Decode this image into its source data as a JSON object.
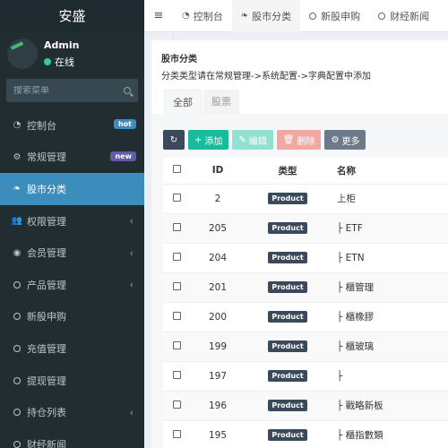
{
  "brand": "安盛",
  "user": {
    "name": "Admin",
    "status": "在线"
  },
  "search": {
    "placeholder": "搜索菜单"
  },
  "menu": [
    {
      "label": "控制台",
      "icon": "dashboard-icon",
      "badge": "hot"
    },
    {
      "label": "常规管理",
      "icon": "cogs-icon",
      "badge": "new"
    },
    {
      "label": "股市分类",
      "icon": "leaf-icon",
      "active": true
    },
    {
      "label": "权限管理",
      "icon": "group-icon",
      "caret": "‹"
    },
    {
      "label": "会员管理",
      "icon": "user-circle-icon",
      "caret": "‹"
    },
    {
      "label": "产品管理",
      "icon": "circle-icon",
      "caret": "‹"
    },
    {
      "label": "新股申购",
      "icon": "circle-icon"
    },
    {
      "label": "充值管理",
      "icon": "circle-icon"
    },
    {
      "label": "提现管理",
      "icon": "circle-icon"
    },
    {
      "label": "持仓列表",
      "icon": "circle-icon",
      "caret": "‹"
    },
    {
      "label": "财经新闻",
      "icon": "circle-icon"
    }
  ],
  "topbar": {
    "tabs": [
      {
        "label": "控制台",
        "icon": "dashboard-icon"
      },
      {
        "label": "股市分类",
        "icon": "leaf-icon",
        "active": true
      },
      {
        "label": "新股申购",
        "icon": "circle-icon"
      },
      {
        "label": "财经新闻",
        "icon": "circle-icon"
      }
    ]
  },
  "panel": {
    "title": "股市分类",
    "description": "分类类型请在常规管理->系统配置->字典配置中添加",
    "subtabs": [
      "全部",
      "股票"
    ]
  },
  "toolbar": {
    "add": "添加",
    "edit": "编辑",
    "delete": "删除",
    "more": "更多"
  },
  "table": {
    "headers": {
      "id": "ID",
      "type": "类型",
      "name": "名称"
    },
    "rows": [
      {
        "id": "2",
        "type": "Product",
        "name": "上柜"
      },
      {
        "id": "205",
        "type": "Product",
        "name": "├ ETF"
      },
      {
        "id": "204",
        "type": "Product",
        "name": "├ ETN"
      },
      {
        "id": "201",
        "type": "Product",
        "name": "├ 櫃管理"
      },
      {
        "id": "200",
        "type": "Product",
        "name": "├ 櫃橡膠"
      },
      {
        "id": "199",
        "type": "Product",
        "name": "├ 櫃玻璃"
      },
      {
        "id": "197",
        "type": "Product",
        "name": "├"
      },
      {
        "id": "196",
        "type": "Product",
        "name": "├ 戰略新板"
      },
      {
        "id": "195",
        "type": "Product",
        "name": "├ 櫃指數類"
      }
    ]
  },
  "colors": {
    "sidebar": "#222d32",
    "active": "#3c8dbc",
    "add": "#18bc9c",
    "edit": "#8fe2cf",
    "delete": "#f0a8a0",
    "more": "#6c7a89"
  }
}
